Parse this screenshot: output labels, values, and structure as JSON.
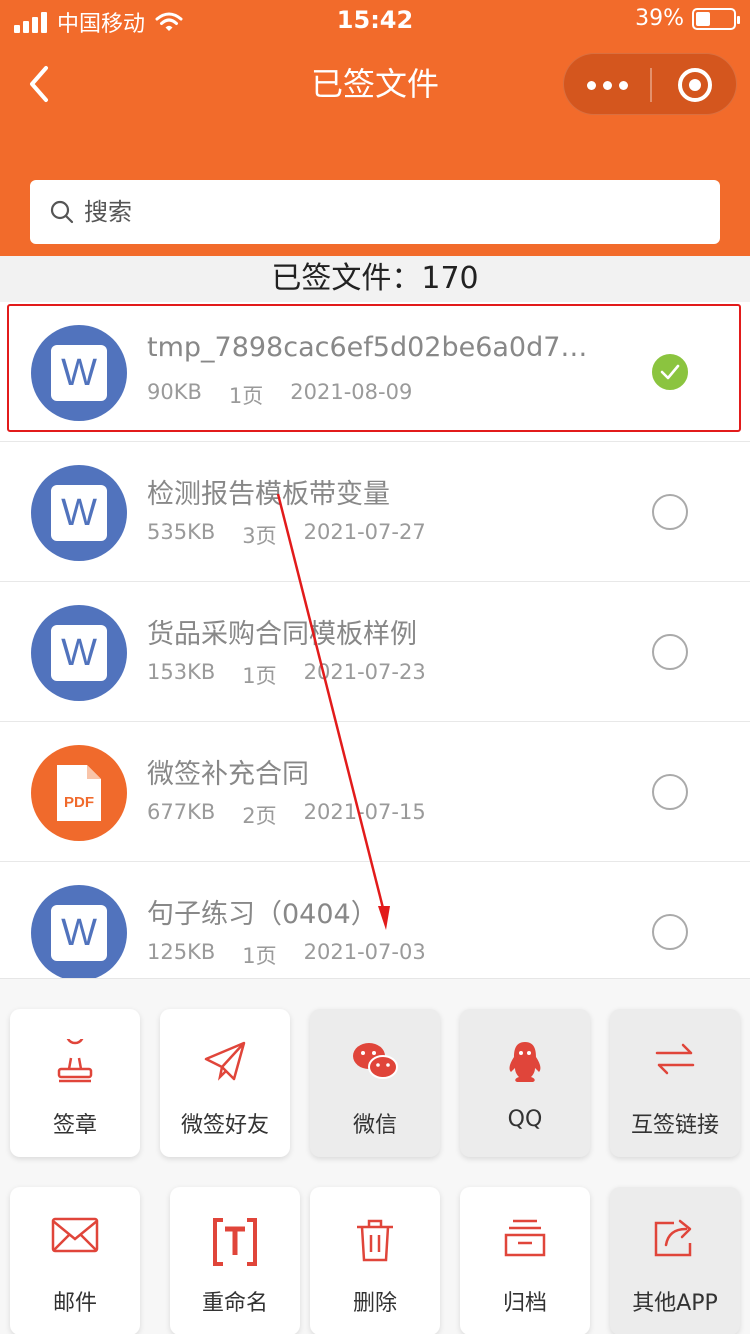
{
  "status_bar": {
    "carrier": "中国移动",
    "time": "15:42",
    "battery": "39%",
    "battery_level": 0.39
  },
  "nav": {
    "title": "已签文件",
    "back_icon": "chevron-left-icon",
    "more_icon": "more-dots-icon",
    "close_icon": "target-circle-icon"
  },
  "search": {
    "placeholder": "搜索"
  },
  "summary": {
    "label": "已签文件：",
    "count": "170"
  },
  "files": [
    {
      "name": "tmp_7898cac6ef5d02be6a0d7…",
      "size": "90KB",
      "pages": "1页",
      "date": "2021-08-09",
      "type": "word",
      "selected": true
    },
    {
      "name": "检测报告模板带变量",
      "size": "535KB",
      "pages": "3页",
      "date": "2021-07-27",
      "type": "word",
      "selected": false
    },
    {
      "name": "货品采购合同模板样例",
      "size": "153KB",
      "pages": "1页",
      "date": "2021-07-23",
      "type": "word",
      "selected": false
    },
    {
      "name": "微签补充合同",
      "size": "677KB",
      "pages": "2页",
      "date": "2021-07-15",
      "type": "pdf",
      "selected": false
    },
    {
      "name": "句子练习（0404）",
      "size": "125KB",
      "pages": "1页",
      "date": "2021-07-03",
      "type": "word",
      "selected": false
    }
  ],
  "file_icon_labels": {
    "word": "W",
    "pdf": "PDF"
  },
  "actions_row1": [
    {
      "label": "签章",
      "icon": "seal-stamp-icon"
    },
    {
      "label": "微签好友",
      "icon": "paper-plane-icon"
    },
    {
      "label": "微信",
      "icon": "wechat-icon"
    },
    {
      "label": "QQ",
      "icon": "qq-penguin-icon"
    },
    {
      "label": "互签链接",
      "icon": "swap-arrows-icon"
    }
  ],
  "actions_row2": [
    {
      "label": "邮件",
      "icon": "envelope-icon"
    },
    {
      "label": "重命名",
      "icon": "rename-text-icon"
    },
    {
      "label": "删除",
      "icon": "trash-icon"
    },
    {
      "label": "归档",
      "icon": "archive-box-icon"
    },
    {
      "label": "其他APP",
      "icon": "share-export-icon"
    }
  ],
  "colors": {
    "brand": "#f26b2b",
    "word": "#5173bd",
    "pdf": "#f06a2c",
    "check": "#8bc43f",
    "action_icon": "#e0453a",
    "annotation": "#e21b1b"
  }
}
